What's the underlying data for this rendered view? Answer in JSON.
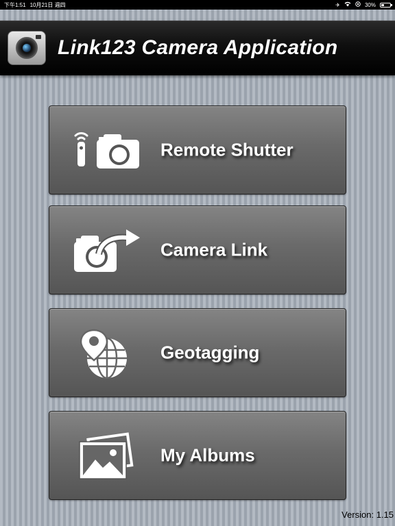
{
  "status_bar": {
    "time": "下午1:51",
    "date": "10月21日 週四",
    "battery": "30%",
    "battery_level": 0.3,
    "icons": [
      "airplane-icon",
      "wifi-icon",
      "location-icon",
      "battery-icon"
    ]
  },
  "header": {
    "title": "Link123 Camera Application",
    "icon": "camera-app-icon"
  },
  "menu": [
    {
      "label": "Remote Shutter",
      "icon": "remote-shutter-icon"
    },
    {
      "label": "Camera Link",
      "icon": "camera-link-icon"
    },
    {
      "label": "Geotagging",
      "icon": "geotagging-icon"
    },
    {
      "label": "My Albums",
      "icon": "albums-icon"
    }
  ],
  "footer": {
    "version": "Version: 1.15"
  },
  "colors": {
    "background": "#a6adb6",
    "header": "#000000",
    "button": "#6a6a6a",
    "text": "#ffffff"
  }
}
